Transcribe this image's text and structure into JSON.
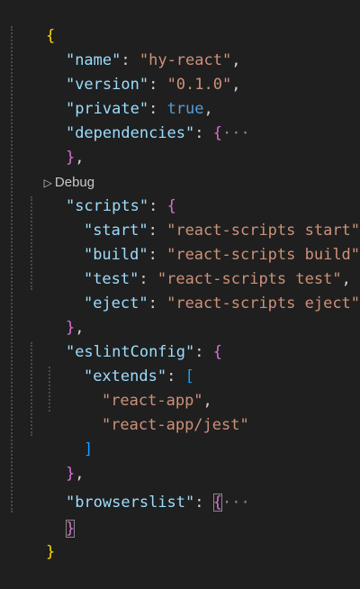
{
  "lines": [
    {
      "open": "{"
    },
    {
      "key": "\"name\"",
      "colon": ": ",
      "val": "\"hy-react\"",
      "end": ","
    },
    {
      "key": "\"version\"",
      "colon": ": ",
      "val": "\"0.1.0\"",
      "end": ","
    },
    {
      "key": "\"private\"",
      "colon": ": ",
      "val": "true",
      "end": ","
    },
    {
      "key": "\"dependencies\"",
      "colon": ": ",
      "open": "{",
      "fold": "···"
    },
    {
      "close": "}",
      "end": ","
    },
    {
      "key": "\"scripts\"",
      "colon": ": ",
      "open": "{"
    },
    {
      "key": "\"start\"",
      "colon": ": ",
      "val": "\"react-scripts start\"",
      "end": ","
    },
    {
      "key": "\"build\"",
      "colon": ": ",
      "val": "\"react-scripts build\"",
      "end": ","
    },
    {
      "key": "\"test\"",
      "colon": ": ",
      "val": "\"react-scripts test\"",
      "end": ","
    },
    {
      "key": "\"eject\"",
      "colon": ": ",
      "val": "\"react-scripts eject\""
    },
    {
      "close": "}",
      "end": ","
    },
    {
      "key": "\"eslintConfig\"",
      "colon": ": ",
      "open": "{"
    },
    {
      "key": "\"extends\"",
      "colon": ": ",
      "open": "["
    },
    {
      "val": "\"react-app\"",
      "end": ","
    },
    {
      "val": "\"react-app/jest\""
    },
    {
      "close": "]"
    },
    {
      "close": "}",
      "end": ","
    },
    {
      "key": "\"browserslist\"",
      "colon": ": ",
      "open": "{",
      "fold": "···"
    },
    {
      "close": "}"
    },
    {
      "close": "}"
    }
  ],
  "codelens": {
    "icon": "play-icon",
    "label": "Debug"
  },
  "colors": {
    "background": "#1f1f1f",
    "key": "#9cdcfe",
    "string": "#ce9178",
    "literal": "#569cd6",
    "bracket_level1": "#ffd700",
    "bracket_level2": "#da70d6",
    "bracket_level3": "#179fff"
  }
}
